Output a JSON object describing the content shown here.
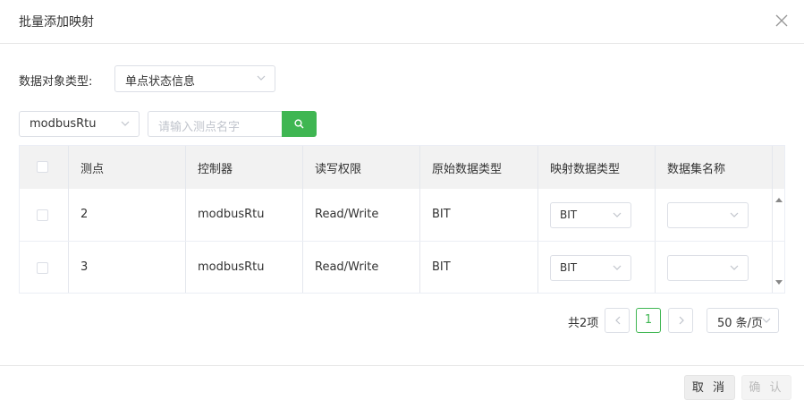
{
  "dialog": {
    "title": "批量添加映射",
    "close_icon": "close-icon"
  },
  "filters": {
    "type_label": "数据对象类型:",
    "type_value": "单点状态信息",
    "controller_value": "modbusRtu",
    "search_placeholder": "请输入测点名字",
    "search_icon": "search-icon"
  },
  "table": {
    "headers": [
      "测点",
      "控制器",
      "读写权限",
      "原始数据类型",
      "映射数据类型",
      "数据集名称"
    ],
    "rows": [
      {
        "point": "2",
        "controller": "modbusRtu",
        "access": "Read/Write",
        "raw_type": "BIT",
        "map_type": "BIT",
        "dataset": ""
      },
      {
        "point": "3",
        "controller": "modbusRtu",
        "access": "Read/Write",
        "raw_type": "BIT",
        "map_type": "BIT",
        "dataset": ""
      }
    ]
  },
  "pagination": {
    "total": "共2项",
    "current_page": "1",
    "page_size": "50 条/页"
  },
  "footer": {
    "cancel_label": "取 消",
    "ok_label": "确 认"
  },
  "colors": {
    "accent": "#3fb652",
    "header_bg": "#f2f2f2",
    "border": "#dcdfe6"
  }
}
